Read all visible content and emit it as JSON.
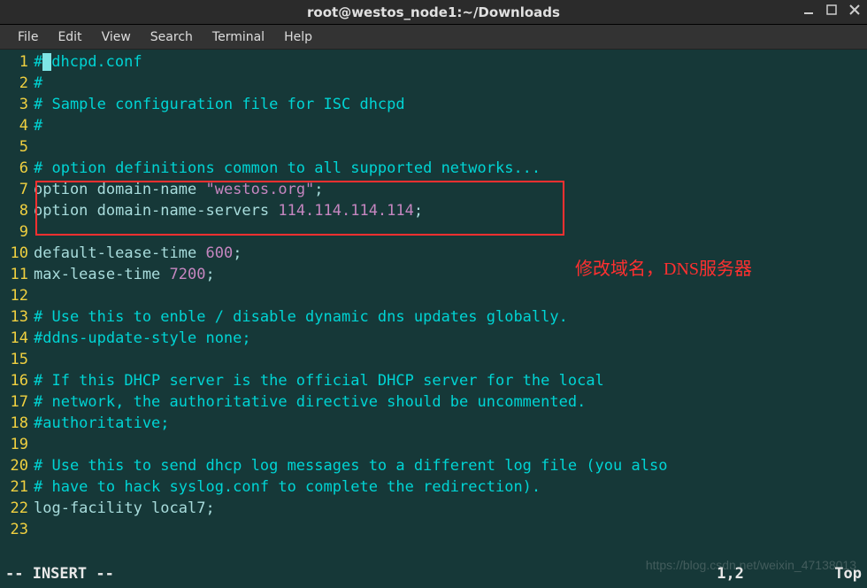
{
  "window": {
    "title": "root@westos_node1:~/Downloads"
  },
  "menu": {
    "file": "File",
    "edit": "Edit",
    "view": "View",
    "search": "Search",
    "terminal": "Terminal",
    "help": "Help"
  },
  "lines": {
    "l1_a": "#",
    "l1_b": "dhcpd.conf",
    "l2": "#",
    "l3": "# Sample configuration file for ISC dhcpd",
    "l4": "#",
    "l5": "",
    "l6": "# option definitions common to all supported networks...",
    "l7_a": "option domain-name ",
    "l7_b": "\"westos.org\"",
    "l7_c": ";",
    "l8_a": "option domain-name-servers ",
    "l8_b": "114.114.114.114",
    "l8_c": ";",
    "l9": "",
    "l10_a": "default-lease-time ",
    "l10_b": "600",
    "l10_c": ";",
    "l11_a": "max-lease-time ",
    "l11_b": "7200",
    "l11_c": ";",
    "l12": "",
    "l13": "# Use this to enble / disable dynamic dns updates globally.",
    "l14": "#ddns-update-style none;",
    "l15": "",
    "l16": "# If this DHCP server is the official DHCP server for the local",
    "l17": "# network, the authoritative directive should be uncommented.",
    "l18": "#authoritative;",
    "l19": "",
    "l20": "# Use this to send dhcp log messages to a different log file (you also",
    "l21": "# have to hack syslog.conf to complete the redirection).",
    "l22_a": "log-facility local7",
    "l22_b": ";",
    "l23": ""
  },
  "line_numbers": [
    "1",
    "2",
    "3",
    "4",
    "5",
    "6",
    "7",
    "8",
    "9",
    "10",
    "11",
    "12",
    "13",
    "14",
    "15",
    "16",
    "17",
    "18",
    "19",
    "20",
    "21",
    "22",
    "23"
  ],
  "annotation": "修改域名，DNS服务器",
  "status": {
    "mode": "-- INSERT --",
    "pos": "1,2",
    "scroll": "Top"
  },
  "watermark": "https://blog.csdn.net/weixin_47138013"
}
